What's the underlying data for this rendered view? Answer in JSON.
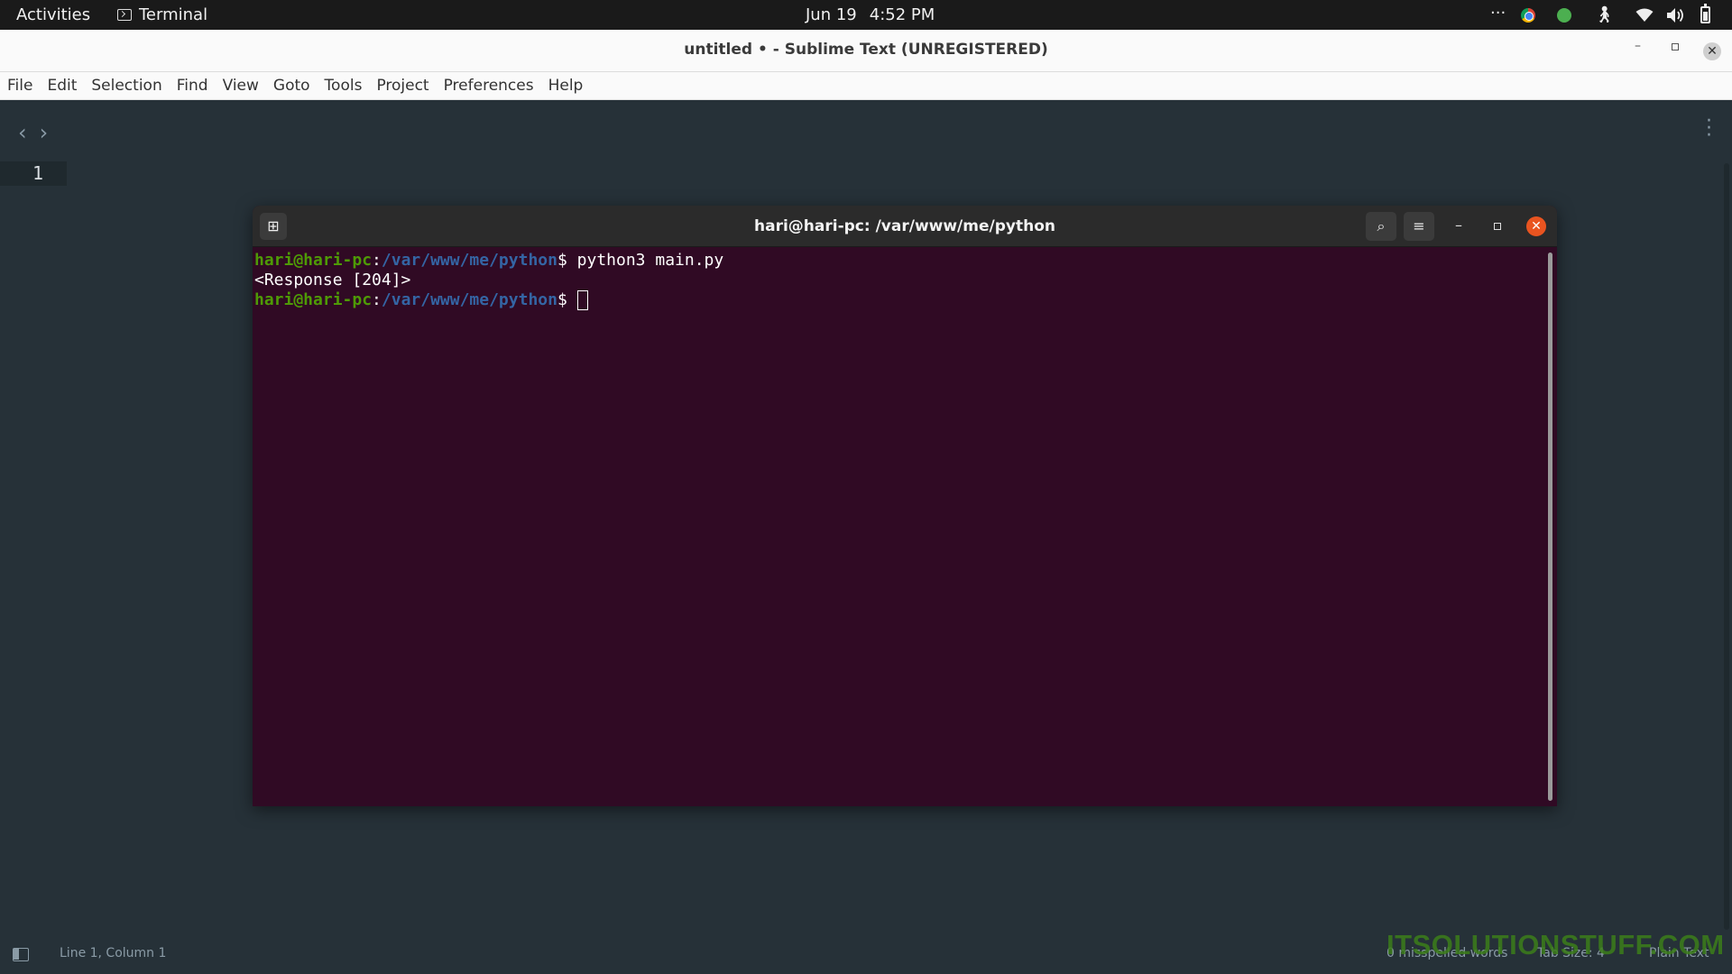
{
  "topbar": {
    "activities": "Activities",
    "app_name": "Terminal",
    "date": "Jun 19",
    "time": "4:52 PM",
    "overflow": "···"
  },
  "sublime": {
    "title": "untitled • - Sublime Text (UNREGISTERED)",
    "menu": [
      "File",
      "Edit",
      "Selection",
      "Find",
      "View",
      "Goto",
      "Tools",
      "Project",
      "Preferences",
      "Help"
    ],
    "gutter_line": "1",
    "status": {
      "position": "Line 1, Column 1",
      "misspelled": "0 misspelled words",
      "tab_size": "Tab Size: 4",
      "syntax": "Plain Text"
    }
  },
  "terminal": {
    "title": "hari@hari-pc: /var/www/me/python",
    "lines": [
      {
        "user": "hari@hari-pc",
        "sep": ":",
        "path": "/var/www/me/python",
        "prompt": "$ ",
        "cmd": "python3 main.py"
      },
      {
        "output": "<Response [204]>"
      },
      {
        "user": "hari@hari-pc",
        "sep": ":",
        "path": "/var/www/me/python",
        "prompt": "$ ",
        "cmd": ""
      }
    ]
  },
  "watermark": "ITSOLUTIONSTUFF.COM",
  "colors": {
    "terminal_bg": "#300a24",
    "editor_bg": "#263138",
    "prompt_user": "#4e9a06",
    "prompt_path": "#3465a4",
    "close_accent": "#e95420"
  }
}
